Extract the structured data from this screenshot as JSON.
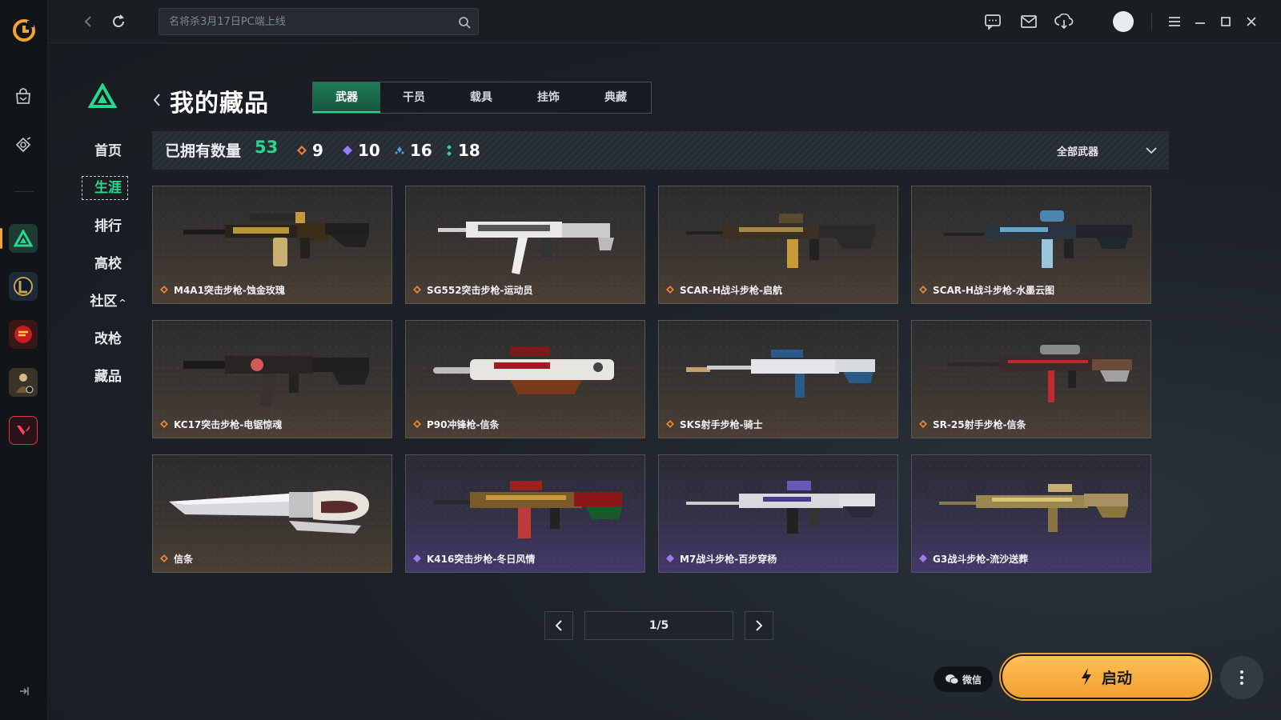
{
  "topbar": {
    "search_placeholder": "名将杀3月17日PC端上线",
    "icons": [
      "chat-icon",
      "mail-icon",
      "download-icon",
      "avatar",
      "menu-icon",
      "minimize-icon",
      "maximize-icon",
      "close-icon"
    ]
  },
  "rail": {
    "items": [
      "app-logo",
      "store-icon",
      "discover-icon",
      "delta-game",
      "lol-game",
      "cf-game",
      "pubg-game",
      "valorant-game"
    ],
    "active": "delta-game"
  },
  "sidenav": {
    "items": [
      "首页",
      "生涯",
      "排行",
      "高校",
      "社区",
      "改枪",
      "藏品"
    ],
    "active_index": 1,
    "community_suffix": "^"
  },
  "page": {
    "title": "我的藏品"
  },
  "tabs": [
    {
      "label": "武器",
      "active": true
    },
    {
      "label": "干员",
      "active": false
    },
    {
      "label": "载具",
      "active": false
    },
    {
      "label": "挂饰",
      "active": false
    },
    {
      "label": "典藏",
      "active": false
    }
  ],
  "stats": {
    "label": "已拥有数量",
    "total": "53",
    "rarities": [
      {
        "icon": "orange-diamond-icon",
        "color": "#e8833a",
        "count": "9"
      },
      {
        "icon": "purple-diamond-icon",
        "color": "#9b7bf0",
        "count": "10"
      },
      {
        "icon": "blue-diamond-icon",
        "color": "#4a9fe8",
        "count": "16"
      },
      {
        "icon": "green-diamond-icon",
        "color": "#27d98e",
        "count": "18"
      }
    ],
    "filter_label": "全部武器"
  },
  "items": [
    {
      "name": "M4A1突击步枪-蚀金玫瑰",
      "rarity": "orange"
    },
    {
      "name": "SG552突击步枪-运动员",
      "rarity": "orange"
    },
    {
      "name": "SCAR-H战斗步枪-启航",
      "rarity": "orange"
    },
    {
      "name": "SCAR-H战斗步枪-水墨云图",
      "rarity": "orange"
    },
    {
      "name": "KC17突击步枪-电锯惊魂",
      "rarity": "orange"
    },
    {
      "name": "P90冲锋枪-信条",
      "rarity": "orange"
    },
    {
      "name": "SKS射手步枪-骑士",
      "rarity": "orange"
    },
    {
      "name": "SR-25射手步枪-信条",
      "rarity": "orange"
    },
    {
      "name": "信条",
      "rarity": "orange"
    },
    {
      "name": "K416突击步枪-冬日风情",
      "rarity": "purple"
    },
    {
      "name": "M7战斗步枪-百步穿杨",
      "rarity": "purple"
    },
    {
      "name": "G3战斗步枪-流沙送葬",
      "rarity": "purple"
    }
  ],
  "pager": {
    "label": "1/5"
  },
  "footer": {
    "wechat_label": "微信",
    "launch_label": "启动"
  },
  "colors": {
    "accent_green": "#27d98e",
    "orange_rarity": "#e8833a",
    "purple_rarity": "#9b7bf0",
    "launch_button": "#f5ac3d"
  }
}
